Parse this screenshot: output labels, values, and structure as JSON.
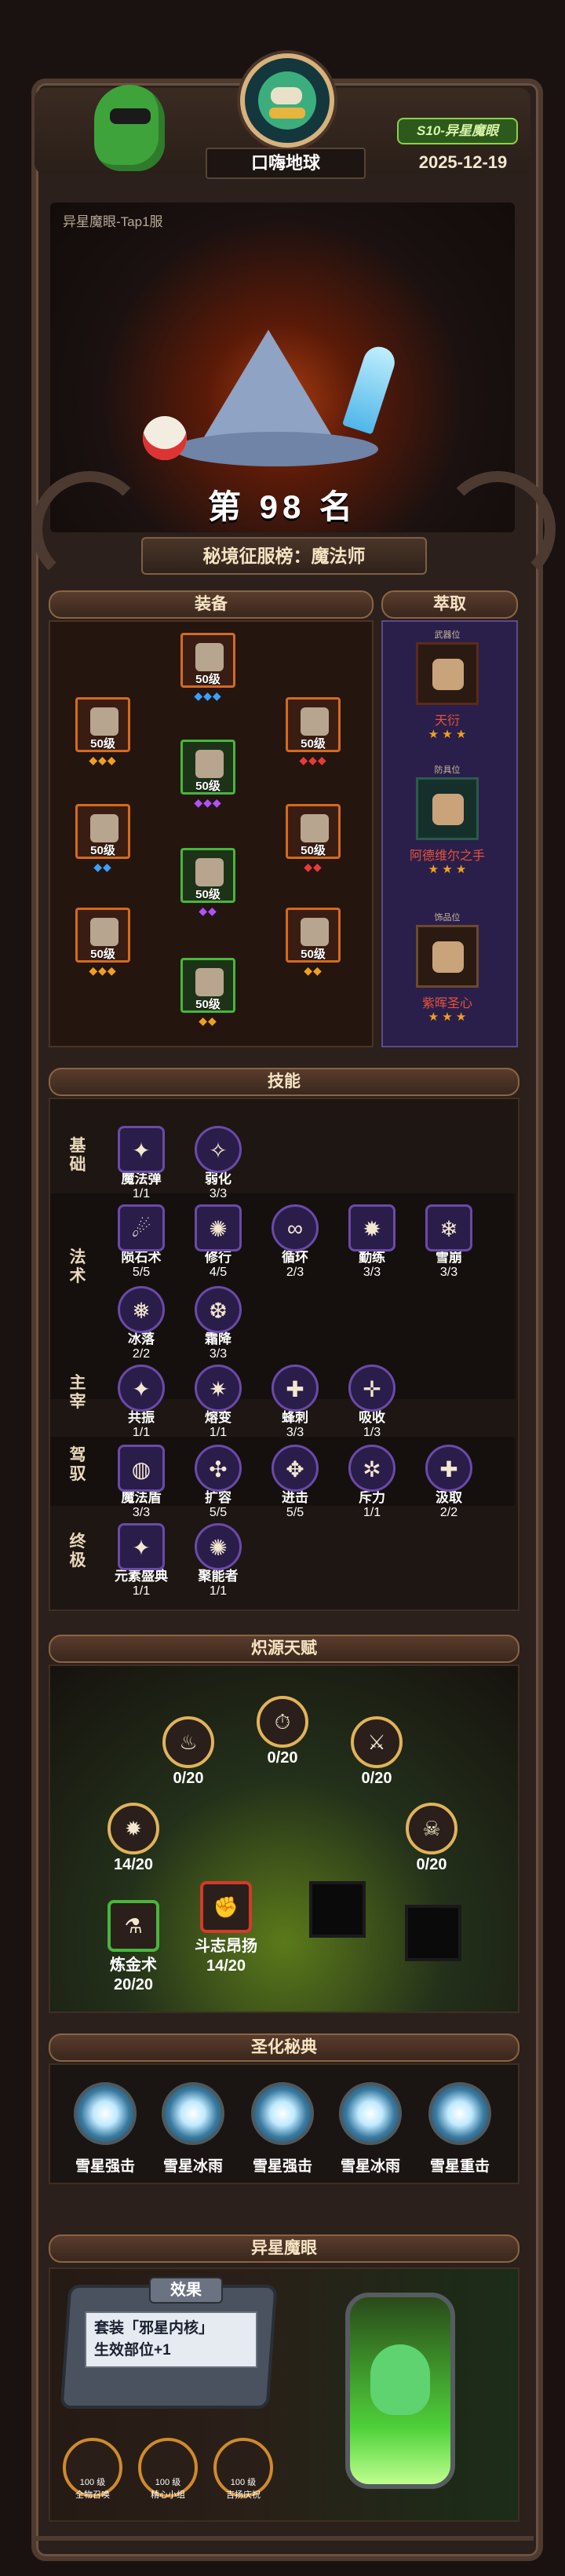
{
  "header": {
    "player_name": "口嗨地球",
    "season_badge": "S10-异星魔眼",
    "date": "2025-12-19"
  },
  "hero": {
    "server": "异星魔眼-Tap1服",
    "rank_text": "第 98 名",
    "rank_label": "秘境征服榜：魔法师"
  },
  "equipment": {
    "title": "装备",
    "slots": [
      {
        "level": "50级",
        "gems": "◆◆◆",
        "gem_color": "blue"
      },
      {
        "level": "50级",
        "gems": "◆◆◆",
        "gem_color": "orange"
      },
      {
        "level": "50级",
        "gems": "◆◆◆",
        "gem_color": "red"
      },
      {
        "level": "50级",
        "gems": "◆◆◆",
        "gem_color": "purple"
      },
      {
        "level": "50级",
        "gems": "◆◆",
        "gem_color": "blue"
      },
      {
        "level": "50级",
        "gems": "◆◆",
        "gem_color": "red"
      },
      {
        "level": "50级",
        "gems": "◆◆",
        "gem_color": "purple"
      },
      {
        "level": "50级",
        "gems": "◆◆◆",
        "gem_color": "orange"
      },
      {
        "level": "50级",
        "gems": "◆◆",
        "gem_color": "orange"
      },
      {
        "level": "50级",
        "gems": "◆◆",
        "gem_color": "orange"
      }
    ]
  },
  "extract": {
    "title": "萃取",
    "items": [
      {
        "tag": "武器位",
        "name": "天衍",
        "stars": "★ ★ ★"
      },
      {
        "tag": "防具位",
        "name": "阿德维尔之手",
        "stars": "★ ★ ★"
      },
      {
        "tag": "饰品位",
        "name": "紫晖圣心",
        "stars": "★ ★ ★"
      }
    ]
  },
  "skills": {
    "title": "技能",
    "rows": [
      {
        "label": "基础",
        "items": [
          {
            "name": "魔法弹",
            "count": "1/1",
            "glyph": "✦"
          },
          {
            "name": "弱化",
            "count": "3/3",
            "glyph": "✧"
          }
        ]
      },
      {
        "label": "法术",
        "items": [
          {
            "name": "陨石术",
            "count": "5/5",
            "glyph": "☄"
          },
          {
            "name": "修行",
            "count": "4/5",
            "glyph": "✺"
          },
          {
            "name": "循环",
            "count": "2/3",
            "glyph": "∞"
          },
          {
            "name": "勤练",
            "count": "3/3",
            "glyph": "✹"
          },
          {
            "name": "雪崩",
            "count": "3/3",
            "glyph": "❄"
          },
          {
            "name": "冰落",
            "count": "2/2",
            "glyph": "❅"
          },
          {
            "name": "霜降",
            "count": "3/3",
            "glyph": "❆"
          }
        ]
      },
      {
        "label": "主宰",
        "items": [
          {
            "name": "共振",
            "count": "1/1",
            "glyph": "✦"
          },
          {
            "name": "熔变",
            "count": "1/1",
            "glyph": "✷"
          },
          {
            "name": "蜂刺",
            "count": "3/3",
            "glyph": "✚"
          },
          {
            "name": "吸收",
            "count": "1/3",
            "glyph": "✛"
          }
        ]
      },
      {
        "label": "驾驭",
        "items": [
          {
            "name": "魔法盾",
            "count": "3/3",
            "glyph": "◍"
          },
          {
            "name": "扩容",
            "count": "5/5",
            "glyph": "✣"
          },
          {
            "name": "进击",
            "count": "5/5",
            "glyph": "✥"
          },
          {
            "name": "斥力",
            "count": "1/1",
            "glyph": "✲"
          },
          {
            "name": "汲取",
            "count": "2/2",
            "glyph": "✚"
          }
        ]
      },
      {
        "label": "终极",
        "items": [
          {
            "name": "元素盛典",
            "count": "1/1",
            "glyph": "✦"
          },
          {
            "name": "聚能者",
            "count": "1/1",
            "glyph": "✺"
          }
        ]
      }
    ]
  },
  "talent": {
    "title": "炽源天赋",
    "nodes": [
      {
        "value": "0/20",
        "glyph": "♨"
      },
      {
        "value": "0/20",
        "glyph": "⏱"
      },
      {
        "value": "0/20",
        "glyph": "⚔"
      },
      {
        "value": "14/20",
        "glyph": "✹"
      },
      {
        "value": "0/20",
        "glyph": "☠"
      }
    ],
    "special": [
      {
        "name": "炼金术",
        "value": "20/20",
        "glyph": "⚗"
      },
      {
        "name": "斗志昂扬",
        "value": "14/20",
        "glyph": "✊"
      }
    ]
  },
  "sacred": {
    "title": "圣化秘典",
    "orbs": [
      "雪星强击",
      "雪星冰雨",
      "雪星强击",
      "雪星冰雨",
      "雪星重击"
    ]
  },
  "alien_eye": {
    "title": "异星魔眼",
    "effect_tab": "效果",
    "effect_line1": "套装「邪星内核」",
    "effect_line2": "生效部位+1",
    "minis": [
      {
        "count": "100 级",
        "name": "全物召唤"
      },
      {
        "count": "100 级",
        "name": "精心小组"
      },
      {
        "count": "100 级",
        "name": "吉扬庆祝"
      }
    ]
  }
}
